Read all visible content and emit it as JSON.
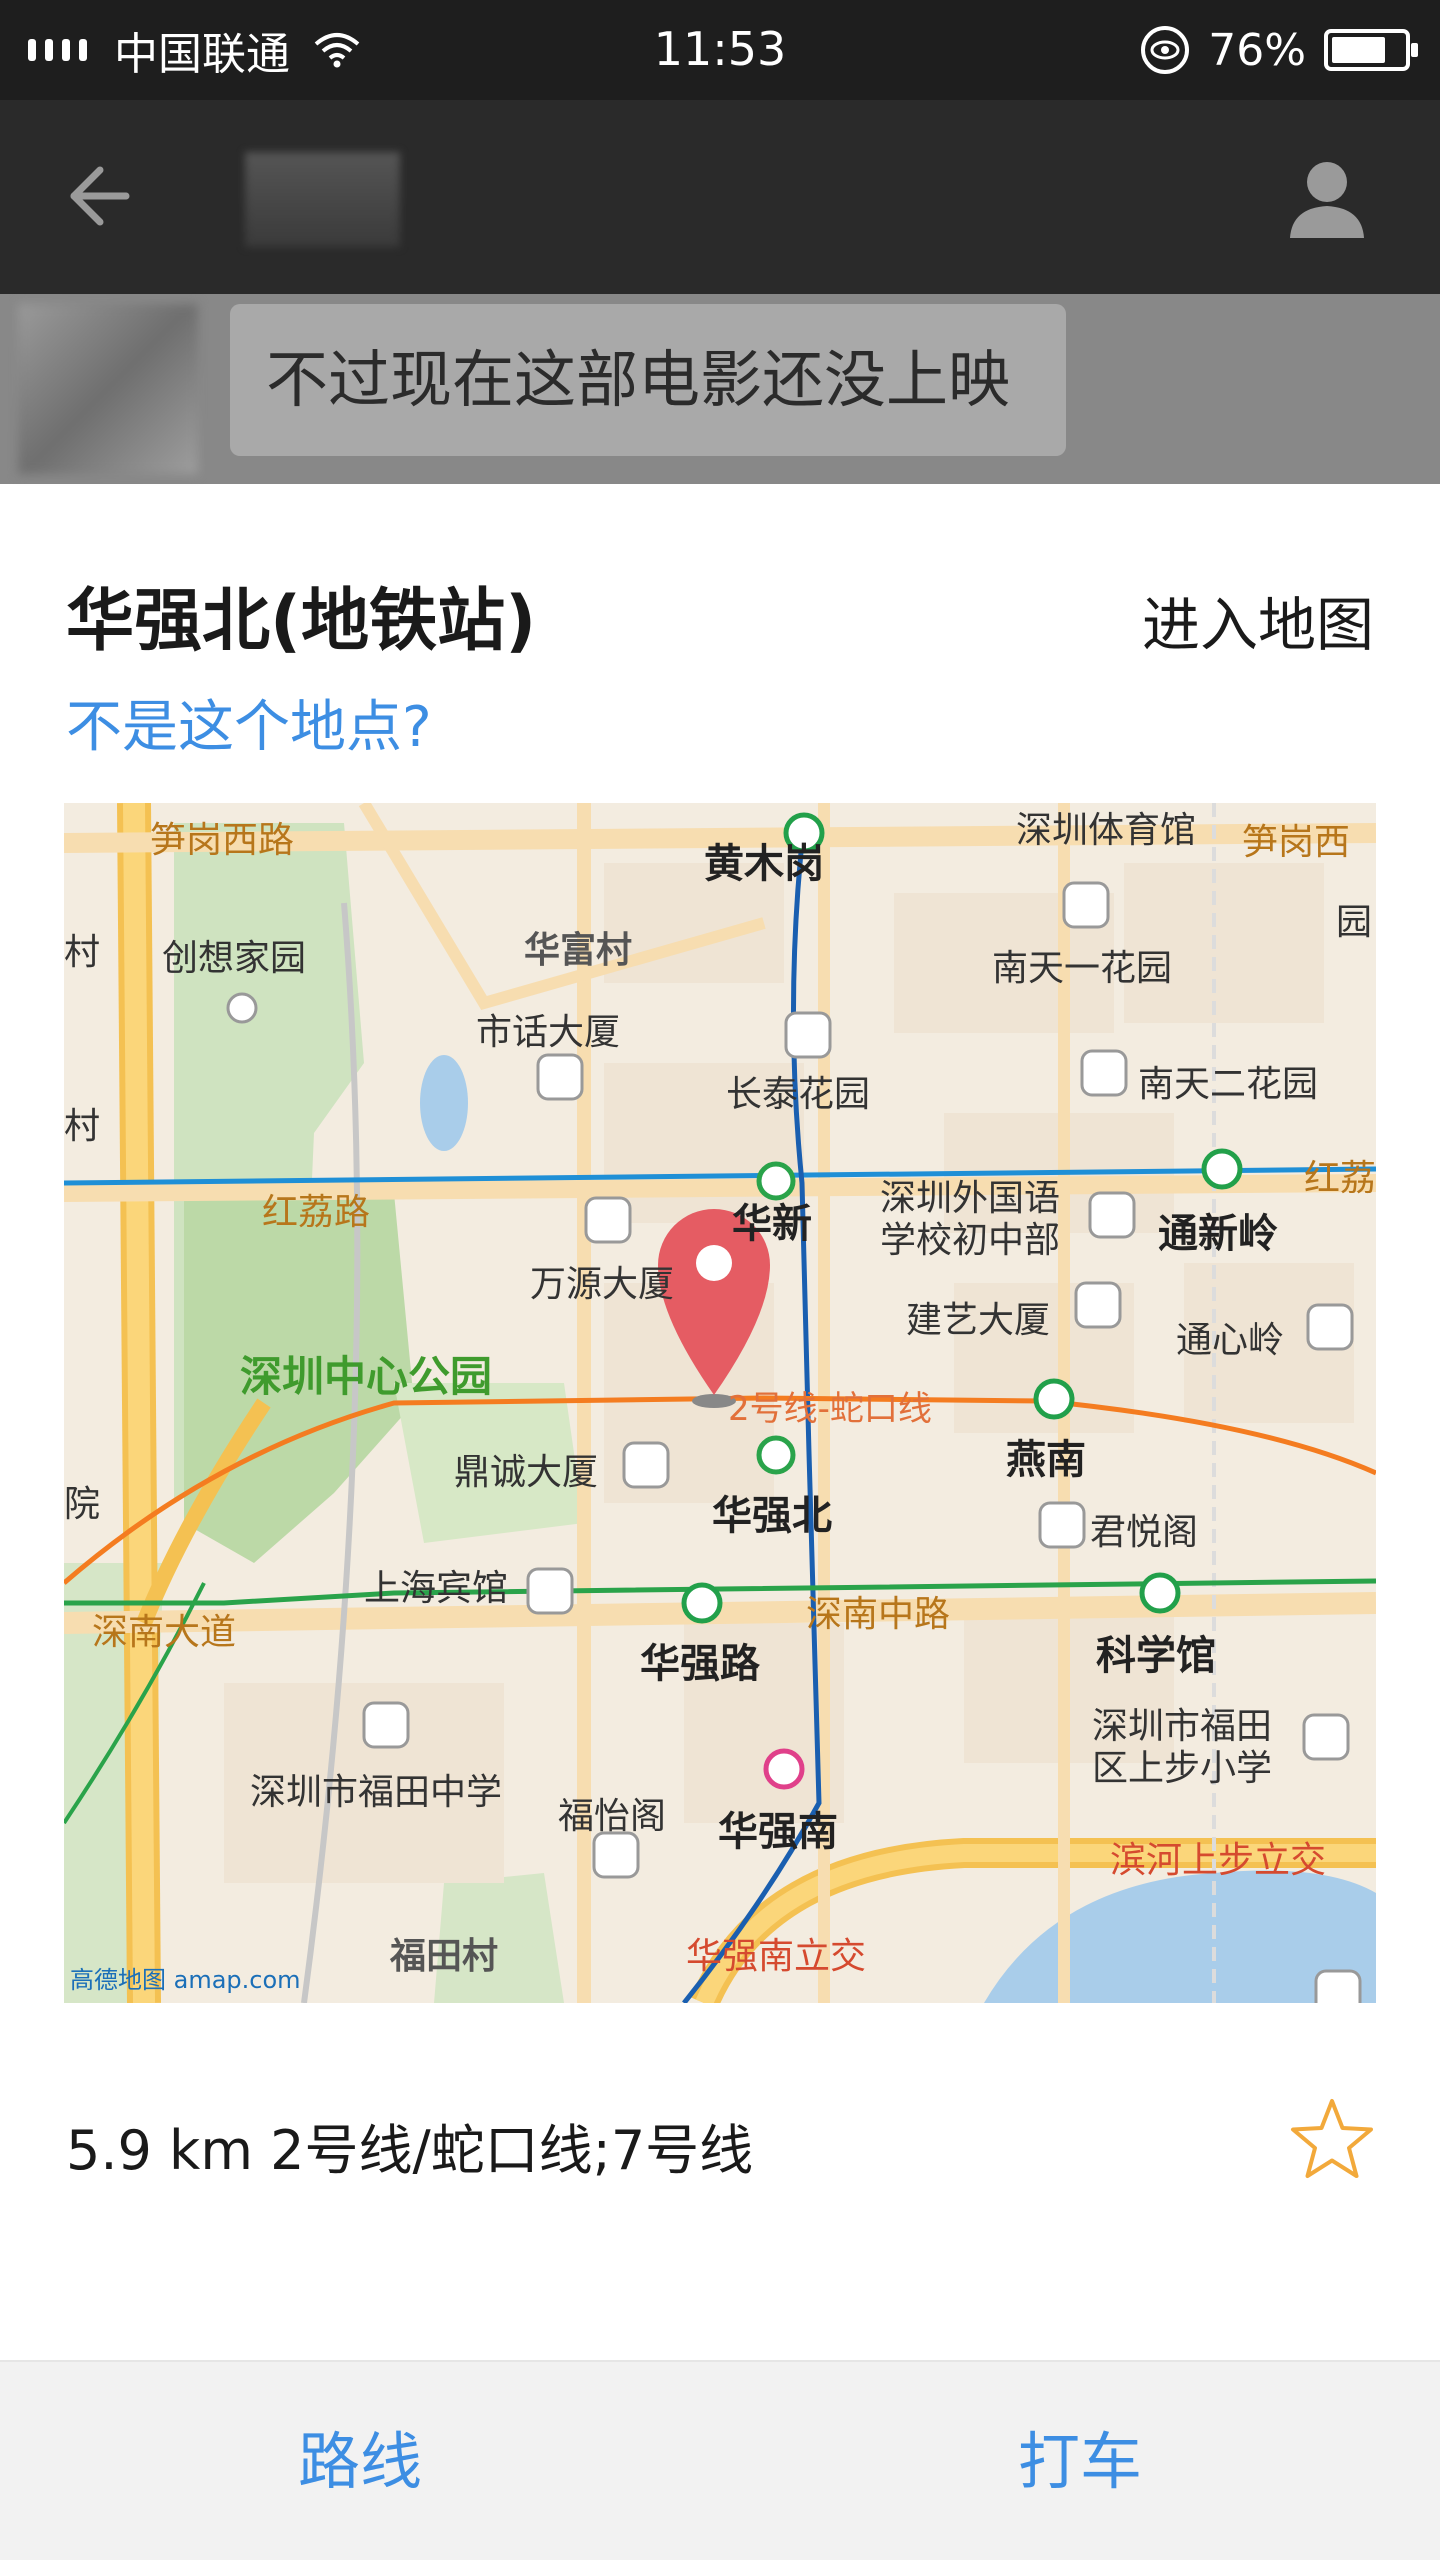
{
  "status_bar": {
    "carrier": "中国联通",
    "time": "11:53",
    "battery": "76%",
    "battery_level": 0.76
  },
  "header": {
    "back_icon": "arrow-left-icon",
    "profile_icon": "person-icon"
  },
  "chat": {
    "message": "不过现在这部电影还没上映"
  },
  "location": {
    "title": "华强北(地铁站)",
    "enter_map": "进入地图",
    "not_this_place": "不是这个地点?",
    "info": "5.9 km 2号线/蛇口线;7号线",
    "favorite_icon": "star-outline-icon"
  },
  "map": {
    "labels": {
      "l1": "笋岗西路",
      "l2": "黄木岗",
      "l3": "深圳体育馆",
      "l4": "笋岗西",
      "l5": "村",
      "l6": "创想家园",
      "l7": "华富村",
      "l8": "南天一花园",
      "l9": "园",
      "l10": "市话大厦",
      "l11": "长泰花园",
      "l12": "南天二花园",
      "l13": "红荔路",
      "l14": "华新",
      "l15": "深圳外国语",
      "l16": "学校初中部",
      "l17": "通新岭",
      "l18": "红荔",
      "l19": "万源大厦",
      "l20": "建艺大厦",
      "l21": "通心岭",
      "l22": "深圳中心公园",
      "l23": "2号线-蛇口线",
      "l24": "燕南",
      "l25": "鼎诚大厦",
      "l26": "华强北",
      "l27": "君悦阁",
      "l28": "上海宾馆",
      "l29": "深南大道",
      "l30": "华强路",
      "l31": "深南中路",
      "l32": "科学馆",
      "l33": "深圳市福田",
      "l34": "区上步小学",
      "l35": "深圳市福田中学",
      "l36": "福怡阁",
      "l37": "华强南",
      "l38": "滨河上步立交",
      "l39": "福田村",
      "l40": "华强南立交",
      "l41": "院",
      "l42": "村"
    },
    "logo": "高德地图 amap.com"
  },
  "bottom_bar": {
    "route": "路线",
    "taxi": "打车"
  }
}
